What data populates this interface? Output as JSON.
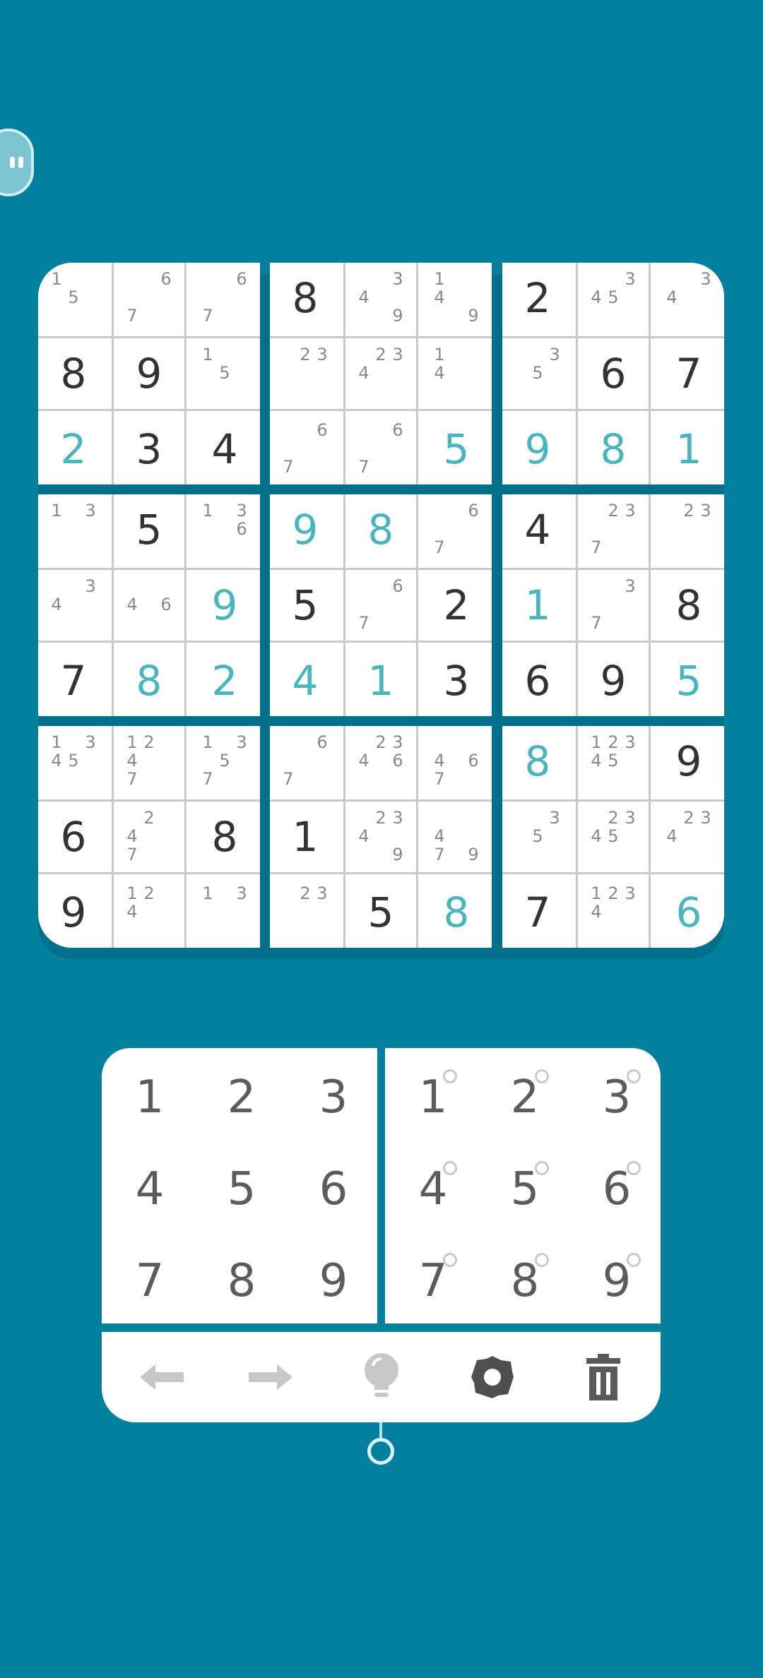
{
  "board": {
    "boxes": [
      {
        "cells": [
          {
            "notes": [
              "1",
              "",
              "",
              "",
              "5",
              "",
              "",
              "",
              ""
            ]
          },
          {
            "notes": [
              "",
              "",
              "6",
              "",
              "",
              "",
              "7",
              "",
              ""
            ]
          },
          {
            "notes": [
              "",
              "",
              "6",
              "",
              "",
              "",
              "7",
              "",
              ""
            ]
          },
          {
            "value": "8",
            "kind": "given"
          },
          {
            "value": "9",
            "kind": "given"
          },
          {
            "notes": [
              "1",
              "",
              "",
              "",
              "5",
              "",
              "",
              "",
              ""
            ]
          },
          {
            "value": "2",
            "kind": "user"
          },
          {
            "value": "3",
            "kind": "given"
          },
          {
            "value": "4",
            "kind": "given"
          }
        ]
      },
      {
        "cells": [
          {
            "value": "8",
            "kind": "given"
          },
          {
            "notes": [
              "",
              "",
              "3",
              "4",
              "",
              "",
              "",
              "",
              "9"
            ]
          },
          {
            "notes": [
              "1",
              "",
              "",
              "4",
              "",
              "",
              "",
              "",
              "9"
            ]
          },
          {
            "notes": [
              "",
              "2",
              "3",
              "",
              "",
              "",
              "",
              "",
              ""
            ]
          },
          {
            "notes": [
              "",
              "2",
              "3",
              "4",
              "",
              "",
              "",
              "",
              ""
            ]
          },
          {
            "notes": [
              "1",
              "",
              "",
              "4",
              "",
              "",
              "",
              "",
              ""
            ]
          },
          {
            "notes": [
              "",
              "",
              "6",
              "",
              "",
              "",
              "7",
              "",
              ""
            ]
          },
          {
            "notes": [
              "",
              "",
              "6",
              "",
              "",
              "",
              "7",
              "",
              ""
            ]
          },
          {
            "value": "5",
            "kind": "user"
          }
        ]
      },
      {
        "cells": [
          {
            "value": "2",
            "kind": "given"
          },
          {
            "notes": [
              "",
              "",
              "3",
              "4",
              "5",
              "",
              "",
              "",
              ""
            ]
          },
          {
            "notes": [
              "",
              "",
              "3",
              "4",
              "",
              "",
              "",
              "",
              ""
            ]
          },
          {
            "notes": [
              "",
              "",
              "3",
              "",
              "5",
              "",
              "",
              "",
              ""
            ]
          },
          {
            "value": "6",
            "kind": "given"
          },
          {
            "value": "7",
            "kind": "given"
          },
          {
            "value": "9",
            "kind": "user"
          },
          {
            "value": "8",
            "kind": "user"
          },
          {
            "value": "1",
            "kind": "user"
          }
        ]
      },
      {
        "cells": [
          {
            "notes": [
              "1",
              "",
              "3",
              "",
              "",
              "",
              "",
              "",
              ""
            ]
          },
          {
            "value": "5",
            "kind": "given"
          },
          {
            "notes": [
              "1",
              "",
              "3",
              "",
              "",
              "6",
              "",
              "",
              ""
            ]
          },
          {
            "notes": [
              "",
              "",
              "3",
              "4",
              "",
              "",
              "",
              "",
              ""
            ]
          },
          {
            "notes": [
              "",
              "",
              "",
              "4",
              "",
              "6",
              "",
              "",
              ""
            ]
          },
          {
            "value": "9",
            "kind": "user"
          },
          {
            "value": "7",
            "kind": "given"
          },
          {
            "value": "8",
            "kind": "user"
          },
          {
            "value": "2",
            "kind": "user"
          }
        ]
      },
      {
        "cells": [
          {
            "value": "9",
            "kind": "user"
          },
          {
            "value": "8",
            "kind": "user"
          },
          {
            "notes": [
              "",
              "",
              "6",
              "",
              "",
              "",
              "7",
              "",
              ""
            ]
          },
          {
            "value": "5",
            "kind": "given"
          },
          {
            "notes": [
              "",
              "",
              "6",
              "",
              "",
              "",
              "7",
              "",
              ""
            ]
          },
          {
            "value": "2",
            "kind": "given"
          },
          {
            "value": "4",
            "kind": "user"
          },
          {
            "value": "1",
            "kind": "user"
          },
          {
            "value": "3",
            "kind": "given"
          }
        ]
      },
      {
        "cells": [
          {
            "value": "4",
            "kind": "given"
          },
          {
            "notes": [
              "",
              "2",
              "3",
              "",
              "",
              "",
              "7",
              "",
              ""
            ]
          },
          {
            "notes": [
              "",
              "2",
              "3",
              "",
              "",
              "",
              "",
              "",
              ""
            ]
          },
          {
            "value": "1",
            "kind": "user"
          },
          {
            "notes": [
              "",
              "",
              "3",
              "",
              "",
              "",
              "7",
              "",
              ""
            ]
          },
          {
            "value": "8",
            "kind": "given"
          },
          {
            "value": "6",
            "kind": "given"
          },
          {
            "value": "9",
            "kind": "given"
          },
          {
            "value": "5",
            "kind": "user"
          }
        ]
      },
      {
        "cells": [
          {
            "notes": [
              "1",
              "",
              "3",
              "4",
              "5",
              "",
              "",
              "",
              ""
            ]
          },
          {
            "notes": [
              "1",
              "2",
              "",
              "4",
              "",
              "",
              "7",
              "",
              ""
            ]
          },
          {
            "notes": [
              "1",
              "",
              "3",
              "",
              "5",
              "",
              "7",
              "",
              ""
            ]
          },
          {
            "value": "6",
            "kind": "given"
          },
          {
            "notes": [
              "",
              "2",
              "",
              "4",
              "",
              "",
              "7",
              "",
              ""
            ]
          },
          {
            "value": "8",
            "kind": "given"
          },
          {
            "value": "9",
            "kind": "given"
          },
          {
            "notes": [
              "1",
              "2",
              "",
              "4",
              "",
              "",
              "",
              "",
              ""
            ]
          },
          {
            "notes": [
              "1",
              "",
              "3",
              "",
              "",
              "",
              "",
              "",
              ""
            ]
          }
        ]
      },
      {
        "cells": [
          {
            "notes": [
              "",
              "",
              "6",
              "",
              "",
              "",
              "7",
              "",
              ""
            ]
          },
          {
            "notes": [
              "",
              "2",
              "3",
              "4",
              "",
              "6",
              "",
              "",
              ""
            ]
          },
          {
            "notes": [
              "",
              "",
              "",
              "4",
              "",
              "6",
              "7",
              "",
              ""
            ]
          },
          {
            "value": "1",
            "kind": "given"
          },
          {
            "notes": [
              "",
              "2",
              "3",
              "4",
              "",
              "",
              "",
              "",
              "9"
            ]
          },
          {
            "notes": [
              "",
              "",
              "",
              "4",
              "",
              "",
              "7",
              "",
              "9"
            ]
          },
          {
            "notes": [
              "",
              "2",
              "3",
              "",
              "",
              "",
              "",
              "",
              ""
            ]
          },
          {
            "value": "5",
            "kind": "given"
          },
          {
            "value": "8",
            "kind": "user"
          }
        ]
      },
      {
        "cells": [
          {
            "value": "8",
            "kind": "user"
          },
          {
            "notes": [
              "1",
              "2",
              "3",
              "4",
              "5",
              "",
              "",
              "",
              ""
            ]
          },
          {
            "value": "9",
            "kind": "given"
          },
          {
            "notes": [
              "",
              "",
              "3",
              "",
              "5",
              "",
              "",
              "",
              ""
            ]
          },
          {
            "notes": [
              "",
              "2",
              "3",
              "4",
              "5",
              "",
              "",
              "",
              ""
            ]
          },
          {
            "notes": [
              "",
              "2",
              "3",
              "4",
              "",
              "",
              "",
              "",
              ""
            ]
          },
          {
            "value": "7",
            "kind": "given"
          },
          {
            "notes": [
              "1",
              "2",
              "3",
              "4",
              "",
              "",
              "",
              "",
              ""
            ]
          },
          {
            "value": "6",
            "kind": "user"
          }
        ]
      }
    ]
  },
  "pad": {
    "digits": [
      "1",
      "2",
      "3",
      "4",
      "5",
      "6",
      "7",
      "8",
      "9"
    ],
    "note_digits": [
      "1",
      "2",
      "3",
      "4",
      "5",
      "6",
      "7",
      "8",
      "9"
    ]
  },
  "toolbar": {
    "tools": [
      "undo-arrow-icon",
      "redo-arrow-icon",
      "hint-bulb-icon",
      "settings-gear-icon",
      "trash-icon"
    ]
  },
  "colors": {
    "background": "#02809e",
    "given_digit": "#333333",
    "user_digit": "#49b5bd",
    "note_digit": "#8a8a8a"
  }
}
